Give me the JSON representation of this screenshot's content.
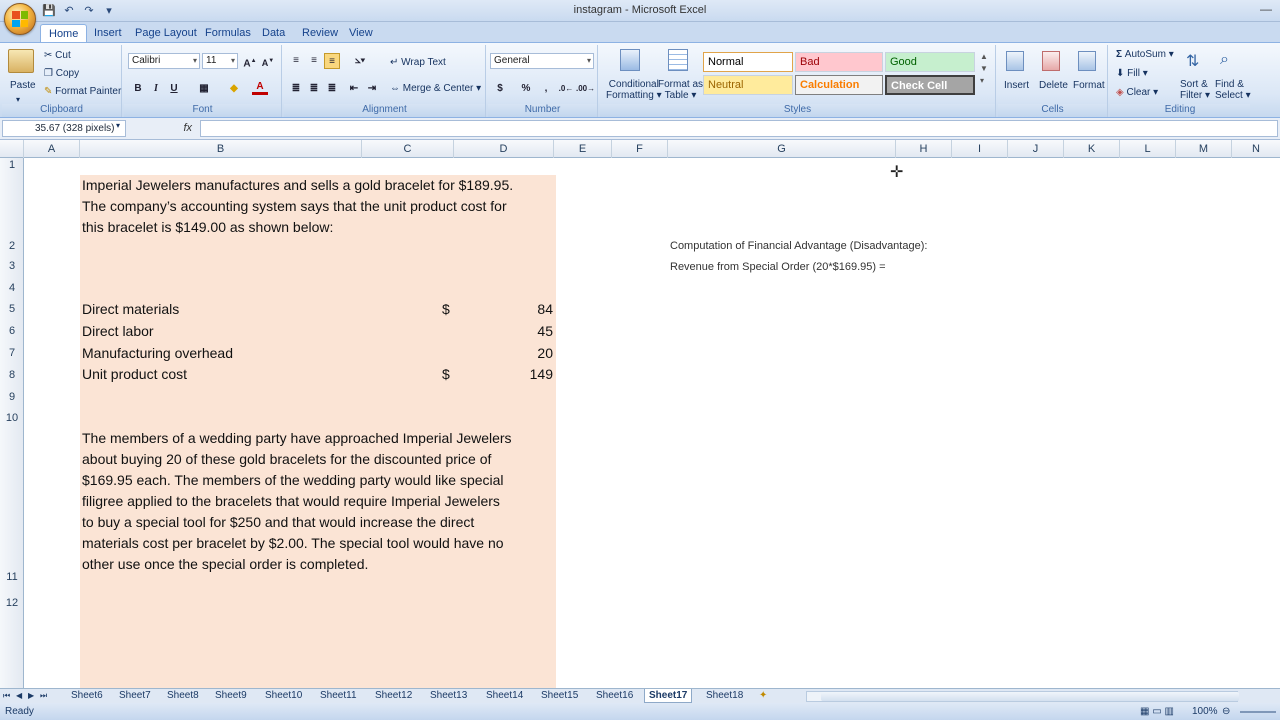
{
  "window": {
    "title": "instagram - Microsoft Excel"
  },
  "ribbon": {
    "tabs": [
      "Home",
      "Insert",
      "Page Layout",
      "Formulas",
      "Data",
      "Review",
      "View"
    ],
    "clipboard": {
      "paste": "Paste",
      "cut": "Cut",
      "copy": "Copy",
      "format_painter": "Format Painter",
      "label": "Clipboard"
    },
    "font": {
      "family": "Calibri",
      "size": "11",
      "label": "Font",
      "bold": "B",
      "italic": "I",
      "underline": "U"
    },
    "alignment": {
      "wrap": "Wrap Text",
      "merge": "Merge & Center",
      "label": "Alignment"
    },
    "number": {
      "format": "General",
      "currency": "$",
      "percent": "%",
      "comma": ",",
      "label": "Number"
    },
    "styles": {
      "conditional": "Conditional",
      "conditional2": "Formatting",
      "format_table": "Format as",
      "format_table2": "Table",
      "normal": "Normal",
      "bad": "Bad",
      "good": "Good",
      "neutral": "Neutral",
      "calculation": "Calculation",
      "check_cell": "Check Cell",
      "label": "Styles"
    },
    "cells": {
      "insert": "Insert",
      "delete": "Delete",
      "format": "Format",
      "label": "Cells"
    },
    "editing": {
      "autosum": "AutoSum",
      "fill": "Fill",
      "clear": "Clear",
      "sort": "Sort &",
      "sort2": "Filter",
      "find": "Find &",
      "find2": "Select",
      "label": "Editing"
    }
  },
  "formula_bar": {
    "name_box": "35.67 (328 pixels)",
    "fx": "fx"
  },
  "columns": [
    "A",
    "B",
    "C",
    "D",
    "E",
    "F",
    "G",
    "H",
    "I",
    "J",
    "K",
    "L",
    "M",
    "N"
  ],
  "rows": [
    "1",
    "2",
    "3",
    "4",
    "5",
    "6",
    "7",
    "8",
    "9",
    "10",
    "11",
    "12"
  ],
  "content": {
    "intro": [
      "Imperial Jewelers manufactures and sells a gold bracelet for $189.95.",
      "The company’s accounting system says that the unit product cost for",
      "this bracelet is $149.00 as shown below:"
    ],
    "cost_table": [
      {
        "label": "Direct materials",
        "currency": "$",
        "value": "84"
      },
      {
        "label": "Direct labor",
        "currency": "",
        "value": "45"
      },
      {
        "label": "Manufacturing overhead",
        "currency": "",
        "value": "20"
      },
      {
        "label": "Unit product cost",
        "currency": "$",
        "value": "149"
      }
    ],
    "scenario": [
      "The members of a wedding party have approached Imperial Jewelers",
      "about buying 20 of these gold bracelets for the discounted price of",
      "$169.95 each. The members of the wedding party would like special",
      "filigree applied to the bracelets that would require Imperial Jewelers",
      "to buy a special tool for $250 and that would increase the direct",
      "materials cost per bracelet by $2.00. The special tool would have no",
      "other use once the special order is completed."
    ],
    "computation_title": "Computation of Financial Advantage (Disadvantage):",
    "computation_line1": "Revenue from Special Order (20*$169.95) ="
  },
  "sheet_tabs": [
    "Sheet6",
    "Sheet7",
    "Sheet8",
    "Sheet9",
    "Sheet10",
    "Sheet11",
    "Sheet12",
    "Sheet13",
    "Sheet14",
    "Sheet15",
    "Sheet16",
    "Sheet17",
    "Sheet18"
  ],
  "active_sheet": "Sheet17",
  "status": {
    "ready": "Ready",
    "zoom": "100%"
  }
}
